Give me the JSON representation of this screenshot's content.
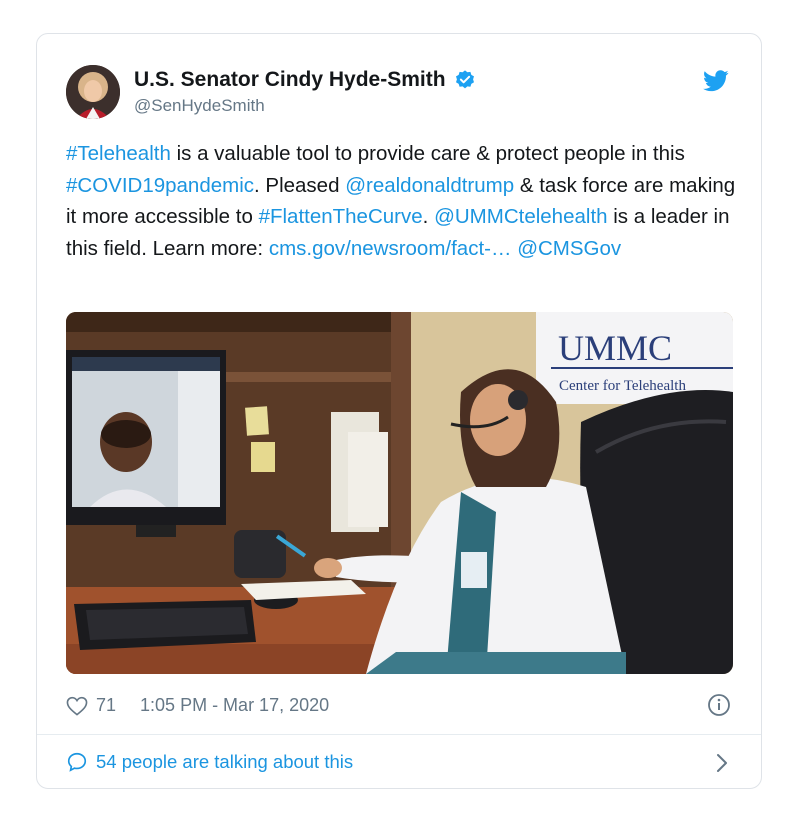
{
  "author": {
    "name": "U.S. Senator Cindy Hyde-Smith",
    "handle": "@SenHydeSmith",
    "verified_icon": "verified-badge-icon",
    "platform_icon": "twitter-bird-icon"
  },
  "tweet": {
    "seg1": "#Telehealth",
    "seg2": " is a valuable tool to provide care & protect people in this ",
    "seg3": "#COVID19pandemic",
    "seg4": ". Pleased ",
    "seg5": "@realdonaldtrump",
    "seg6": " & task force are making it more accessible to ",
    "seg7": "#FlattenTheCurve",
    "seg8": ". ",
    "seg9": "@UMMCtelehealth",
    "seg10": " is a leader in this field. Learn more: ",
    "seg11": "cms.gov/newsroom/fact-…",
    "seg12": " ",
    "seg13": "@CMSGov"
  },
  "photo": {
    "sign_title": "UMMC",
    "sign_subtitle": "Center for Telehealth"
  },
  "meta": {
    "likes": "71",
    "timestamp": "1:05 PM - Mar 17, 2020"
  },
  "footer": {
    "talking": "54 people are talking about this"
  },
  "colors": {
    "link": "#1b95e0",
    "text": "#14171a",
    "secondary": "#657786"
  }
}
